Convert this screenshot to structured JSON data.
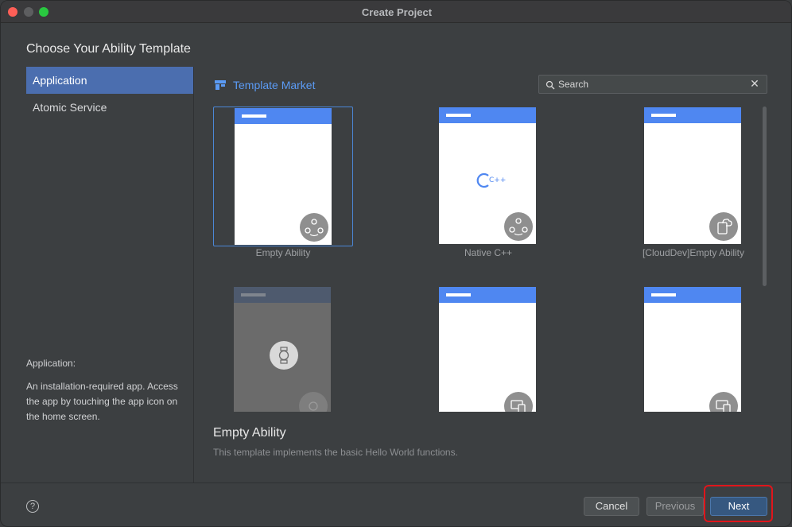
{
  "window": {
    "title": "Create Project"
  },
  "heading": "Choose Your Ability Template",
  "sidebar": {
    "items": [
      {
        "label": "Application",
        "selected": true
      },
      {
        "label": "Atomic Service",
        "selected": false
      }
    ],
    "description_title": "Application:",
    "description": "An installation-required app. Access the app by touching the app icon on the home screen."
  },
  "market": {
    "label": "Template Market",
    "icon": "template-market-icon"
  },
  "search": {
    "placeholder": "Search"
  },
  "templates": [
    {
      "label": "Empty Ability",
      "icon": "ability-circle-icon",
      "selected": true
    },
    {
      "label": "Native C++",
      "icon": "ability-circle-icon",
      "center": "C++"
    },
    {
      "label": "[CloudDev]Empty Ability",
      "icon": "cloud-phone-icon"
    },
    {
      "label": "",
      "icon": "watch-icon"
    },
    {
      "label": "",
      "icon": "multi-device-icon"
    },
    {
      "label": "",
      "icon": "multi-device-icon"
    }
  ],
  "selected_template": {
    "title": "Empty Ability",
    "description": "This template implements the basic Hello World functions."
  },
  "footer": {
    "help": "?",
    "cancel": "Cancel",
    "previous": "Previous",
    "next": "Next"
  },
  "colors": {
    "accent": "#4f87f1",
    "selection": "#4b6eaf",
    "highlight": "#e0151b"
  }
}
